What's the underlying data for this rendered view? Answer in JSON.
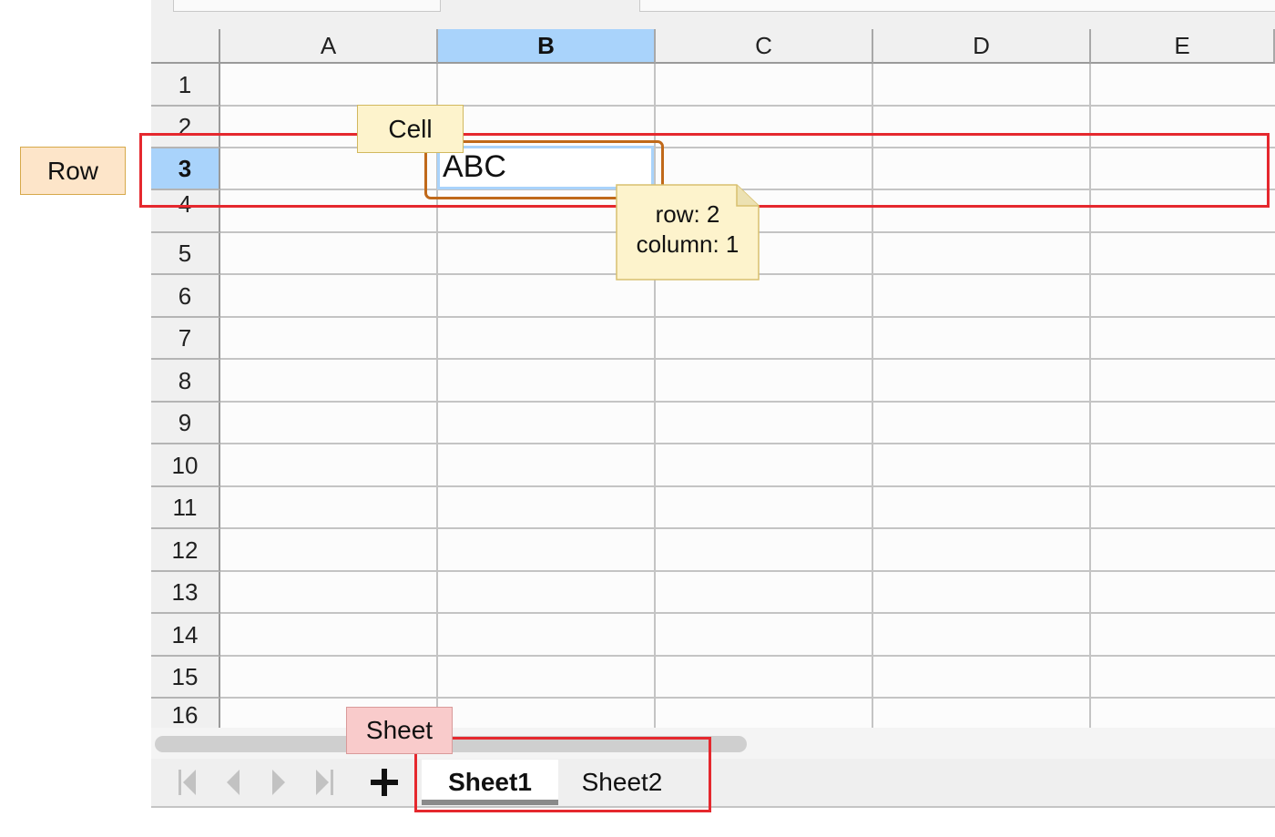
{
  "columns": [
    "A",
    "B",
    "C",
    "D",
    "E"
  ],
  "selected_column": "B",
  "rows": [
    "1",
    "2",
    "3",
    "4",
    "5",
    "6",
    "7",
    "8",
    "9",
    "10",
    "11",
    "12",
    "13",
    "14",
    "15",
    "16"
  ],
  "selected_row": "3",
  "cell_value": "ABC",
  "annotations": {
    "row": "Row",
    "cell": "Cell",
    "sheet": "Sheet",
    "note_row": "row: 2",
    "note_column": "column: 1"
  },
  "tabs": [
    "Sheet1",
    "Sheet2"
  ],
  "active_tab": "Sheet1",
  "icons": {
    "first": "first-page-icon",
    "prev": "previous-icon",
    "next": "next-icon",
    "last": "last-page-icon",
    "add": "plus-icon"
  },
  "colors": {
    "selection": "#a9d3fb",
    "highlight_red": "#e5282e",
    "highlight_orange": "#c0691a",
    "row_label_bg": "#fde5c9",
    "cell_label_bg": "#fdf3cc",
    "sheet_label_bg": "#f9cbcb"
  }
}
